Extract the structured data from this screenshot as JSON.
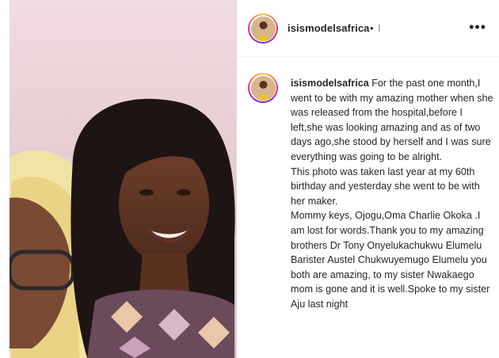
{
  "post": {
    "username": "isismodelsafrica",
    "follow_separator": "•",
    "follow_hint": "I",
    "more_icon": "more-horizontal-icon",
    "caption_user": "isismodelsafrica",
    "caption_text": "For the past one month,I went to be with my amazing mother when she was released from the hospital,before I left,she was looking amazing and as of two days ago,she stood by herself and I was sure everything was going to be alright.\nThis photo was taken last year at my 60th birthday and yesterday she went to be with her maker.\nMommy keys, Ojogu,Oma Charlie Okoka .I am lost for words.Thank you to my amazing brothers Dr Tony Onyelukachukwu Elumelu Barister Austel Chukwuyemugo Elumelu you both are amazing, to my sister Nwakaego mom is gone and it is well.Spoke to my sister Aju last night"
  },
  "colors": {
    "text": "#262626",
    "border": "#dbdbdb",
    "secondary": "#8e8e8e"
  }
}
